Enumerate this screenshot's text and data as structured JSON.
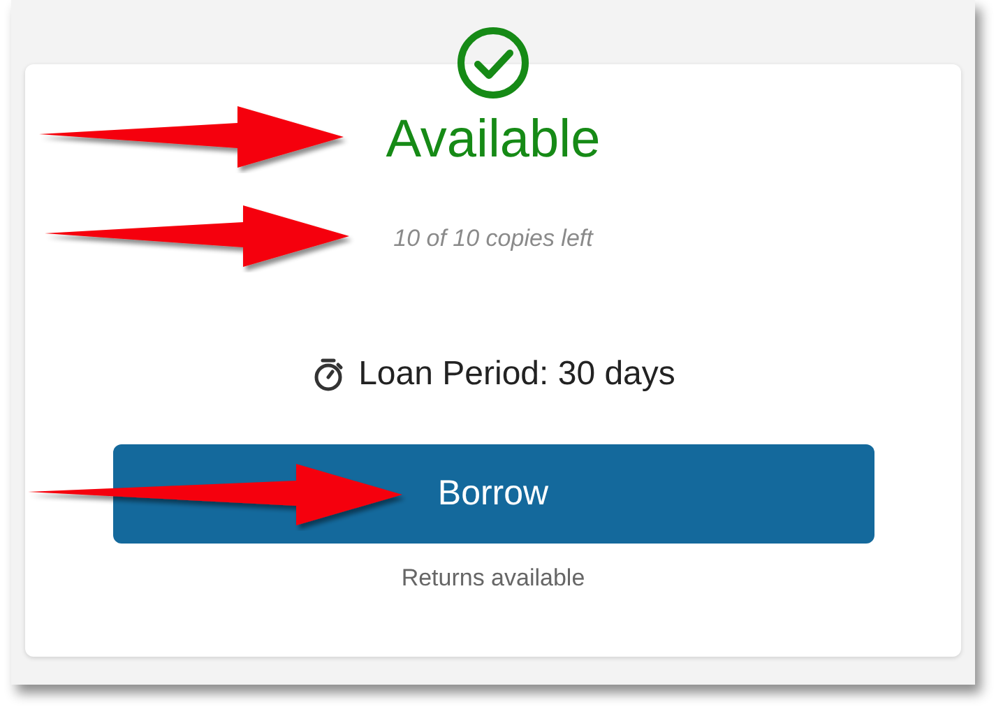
{
  "status": {
    "kind": "available",
    "label": "Available",
    "copies": "10 of 10 copies left"
  },
  "loan_period": "Loan Period: 30 days",
  "borrow_button": {
    "label": "Borrow"
  },
  "returns_note": "Returns available"
}
